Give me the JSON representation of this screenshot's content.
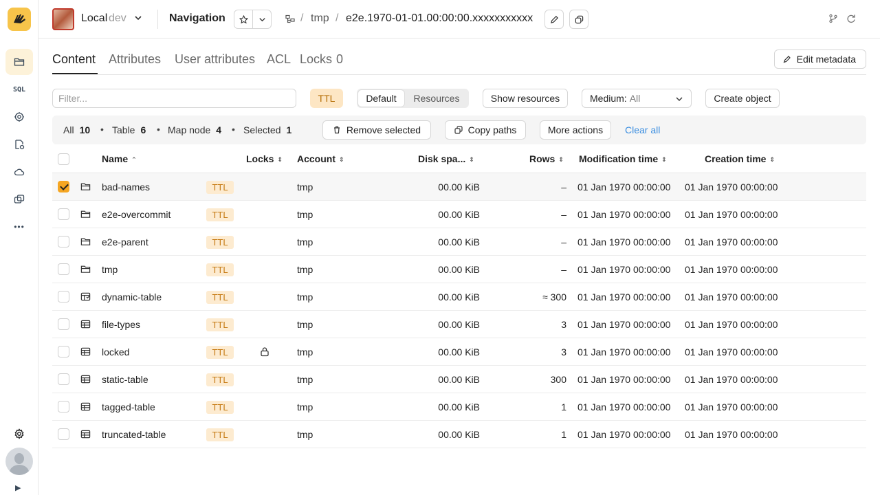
{
  "sidebar": {
    "logo_text": "🐝",
    "items": [
      "folder-icon",
      "sql-icon",
      "gear-cluster-icon",
      "operations-icon",
      "cloud-icon",
      "accounts-icon",
      "more-icon"
    ],
    "sql_label": "SQL",
    "more_label": "•••",
    "expand_label": "▶"
  },
  "header": {
    "cluster_name": "Local",
    "cluster_env": "dev",
    "page_title": "Navigation",
    "breadcrumb": [
      "tmp"
    ],
    "breadcrumb_sep": "/",
    "current_node": "e2e.1970-01-01.00:00:00.xxxxxxxxxxx"
  },
  "tabs": [
    {
      "label": "Content"
    },
    {
      "label": "Attributes"
    },
    {
      "label": "User attributes"
    },
    {
      "label": "ACL"
    },
    {
      "label": "Locks",
      "count": "0"
    }
  ],
  "edit_metadata_label": "Edit metadata",
  "toolbar": {
    "filter_placeholder": "Filter...",
    "ttl_label": "TTL",
    "view_default": "Default",
    "view_resources": "Resources",
    "show_resources": "Show resources",
    "medium_label": "Medium:",
    "medium_value": "All",
    "create_object": "Create object"
  },
  "summary": {
    "all_label": "All",
    "all_count": "10",
    "table_label": "Table",
    "table_count": "6",
    "map_label": "Map node",
    "map_count": "4",
    "selected_label": "Selected",
    "selected_count": "1",
    "bullet": "•",
    "remove_selected": "Remove selected",
    "copy_paths": "Copy paths",
    "more_actions": "More actions",
    "clear_all": "Clear all"
  },
  "columns": {
    "name": "Name",
    "locks": "Locks",
    "account": "Account",
    "disk": "Disk spa...",
    "rows": "Rows",
    "mtime": "Modification time",
    "ctime": "Creation time"
  },
  "rows": [
    {
      "name": "bad-names",
      "type": "map_node",
      "ttl": "TTL",
      "account": "tmp",
      "disk": "00.00 KiB",
      "rows": "–",
      "mtime": "01 Jan 1970 00:00:00",
      "ctime": "01 Jan 1970 00:00:00",
      "checked": true,
      "locked": false
    },
    {
      "name": "e2e-overcommit",
      "type": "map_node",
      "ttl": "TTL",
      "account": "tmp",
      "disk": "00.00 KiB",
      "rows": "–",
      "mtime": "01 Jan 1970 00:00:00",
      "ctime": "01 Jan 1970 00:00:00",
      "checked": false,
      "locked": false
    },
    {
      "name": "e2e-parent",
      "type": "map_node",
      "ttl": "TTL",
      "account": "tmp",
      "disk": "00.00 KiB",
      "rows": "–",
      "mtime": "01 Jan 1970 00:00:00",
      "ctime": "01 Jan 1970 00:00:00",
      "checked": false,
      "locked": false
    },
    {
      "name": "tmp",
      "type": "map_node",
      "ttl": "TTL",
      "account": "tmp",
      "disk": "00.00 KiB",
      "rows": "–",
      "mtime": "01 Jan 1970 00:00:00",
      "ctime": "01 Jan 1970 00:00:00",
      "checked": false,
      "locked": false
    },
    {
      "name": "dynamic-table",
      "type": "dynamic_table",
      "ttl": "TTL",
      "account": "tmp",
      "disk": "00.00 KiB",
      "rows": "≈ 300",
      "mtime": "01 Jan 1970 00:00:00",
      "ctime": "01 Jan 1970 00:00:00",
      "checked": false,
      "locked": false
    },
    {
      "name": "file-types",
      "type": "table",
      "ttl": "TTL",
      "account": "tmp",
      "disk": "00.00 KiB",
      "rows": "3",
      "mtime": "01 Jan 1970 00:00:00",
      "ctime": "01 Jan 1970 00:00:00",
      "checked": false,
      "locked": false
    },
    {
      "name": "locked",
      "type": "table",
      "ttl": "TTL",
      "account": "tmp",
      "disk": "00.00 KiB",
      "rows": "3",
      "mtime": "01 Jan 1970 00:00:00",
      "ctime": "01 Jan 1970 00:00:00",
      "checked": false,
      "locked": true
    },
    {
      "name": "static-table",
      "type": "table",
      "ttl": "TTL",
      "account": "tmp",
      "disk": "00.00 KiB",
      "rows": "300",
      "mtime": "01 Jan 1970 00:00:00",
      "ctime": "01 Jan 1970 00:00:00",
      "checked": false,
      "locked": false
    },
    {
      "name": "tagged-table",
      "type": "table",
      "ttl": "TTL",
      "account": "tmp",
      "disk": "00.00 KiB",
      "rows": "1",
      "mtime": "01 Jan 1970 00:00:00",
      "ctime": "01 Jan 1970 00:00:00",
      "checked": false,
      "locked": false
    },
    {
      "name": "truncated-table",
      "type": "table",
      "ttl": "TTL",
      "account": "tmp",
      "disk": "00.00 KiB",
      "rows": "1",
      "mtime": "01 Jan 1970 00:00:00",
      "ctime": "01 Jan 1970 00:00:00",
      "checked": false,
      "locked": false
    }
  ]
}
